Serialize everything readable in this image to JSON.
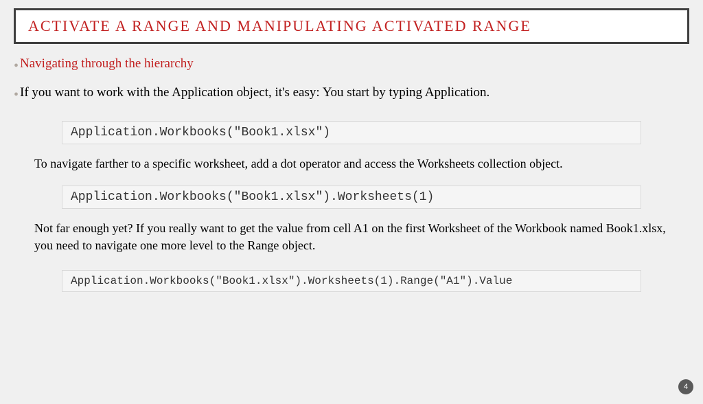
{
  "title": "ACTIVATE A RANGE AND MANIPULATING ACTIVATED RANGE",
  "bullet1": "Navigating through the hierarchy",
  "bullet2": "If you want to work with the Application object, it's easy: You start by typing Application.",
  "code1": "Application.Workbooks(\"Book1.xlsx\")",
  "para1": "To navigate farther to a specific worksheet, add a dot operator and access the Worksheets collection object.",
  "code2": "Application.Workbooks(\"Book1.xlsx\").Worksheets(1)",
  "para2": "Not far enough yet? If you really want to get the value from cell A1 on the first Worksheet of the Workbook named Book1.xlsx, you need to navigate one more level to the Range object.",
  "code3": "Application.Workbooks(\"Book1.xlsx\").Worksheets(1).Range(\"A1\").Value",
  "pageNumber": "4"
}
